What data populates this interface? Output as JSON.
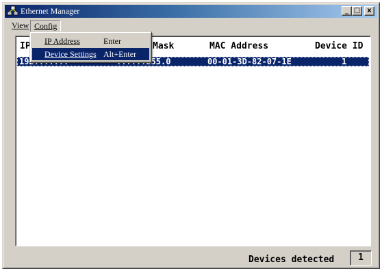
{
  "window": {
    "title": "Ethernet Manager"
  },
  "titlebar": {
    "minimize": "_",
    "maximize": "□",
    "close": "x"
  },
  "menubar": {
    "view": "View",
    "config": "Config"
  },
  "config_menu": {
    "items": [
      {
        "label": "IP Address",
        "shortcut": "Enter"
      },
      {
        "label": "Device Settings",
        "shortcut": "Alt+Enter"
      }
    ]
  },
  "list": {
    "columns": [
      "IP",
      "Mask",
      "MAC Address",
      "Device ID"
    ],
    "rows": [
      {
        "ip": "192.......",
        "mask": "......255.0",
        "mac": "00-01-3D-82-07-1E",
        "device_id": "1"
      }
    ]
  },
  "status": {
    "label": "Devices detected",
    "count": "1"
  },
  "colors": {
    "title_active": "#0a246a",
    "selection": "#0a246a",
    "face": "#d4d0c8"
  }
}
